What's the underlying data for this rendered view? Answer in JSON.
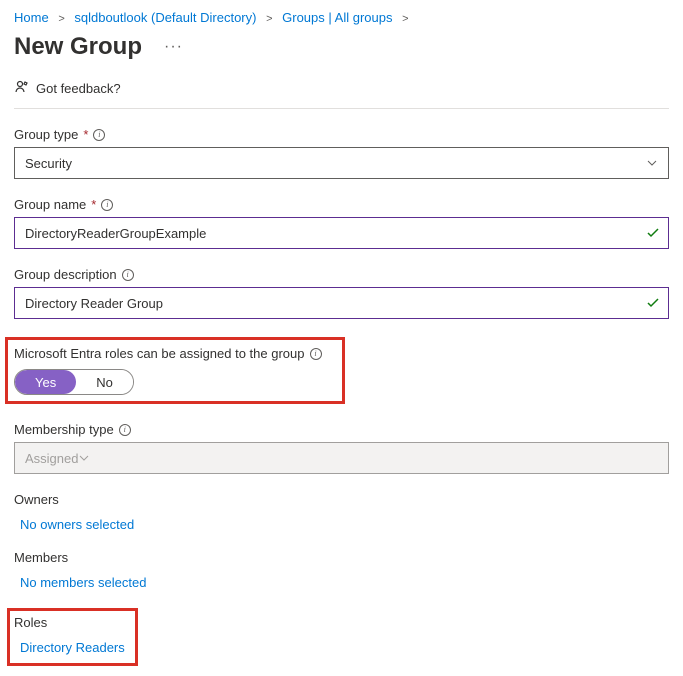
{
  "breadcrumb": {
    "home": "Home",
    "tenant": "sqldboutlook (Default Directory)",
    "groups": "Groups | All groups"
  },
  "page_title": "New Group",
  "feedback_label": "Got feedback?",
  "fields": {
    "group_type": {
      "label": "Group type",
      "value": "Security"
    },
    "group_name": {
      "label": "Group name",
      "value": "DirectoryReaderGroupExample"
    },
    "group_description": {
      "label": "Group description",
      "value": "Directory Reader Group"
    },
    "entra_roles": {
      "label": "Microsoft Entra roles can be assigned to the group",
      "yes": "Yes",
      "no": "No"
    },
    "membership_type": {
      "label": "Membership type",
      "value": "Assigned"
    }
  },
  "sections": {
    "owners": {
      "heading": "Owners",
      "link": "No owners selected"
    },
    "members": {
      "heading": "Members",
      "link": "No members selected"
    },
    "roles": {
      "heading": "Roles",
      "link": "Directory Readers"
    }
  }
}
